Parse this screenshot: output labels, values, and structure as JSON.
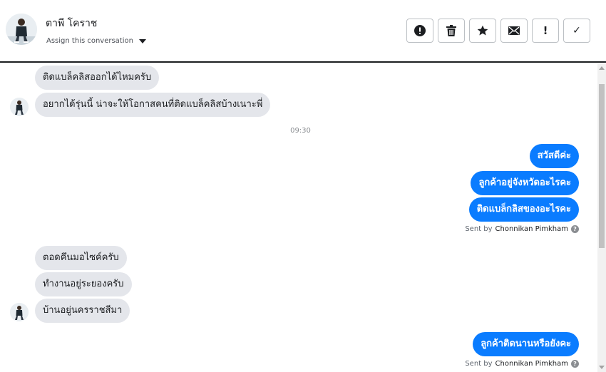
{
  "header": {
    "contact_name": "ตาพี โคราช",
    "assign_label": "Assign this conversation",
    "actions": {
      "spam": "exclamation-circle-icon",
      "delete": "trash-icon",
      "star": "star-icon",
      "mark_unread": "envelope-icon",
      "follow_up": "exclamation-icon",
      "done": "checkmark-icon"
    },
    "action_labels": [
      "!",
      "✓"
    ]
  },
  "conversation": {
    "group1": [
      "ติดแบล็คลิสออกได้ไหมครับ",
      "อยากได้รุ่นนี้ น่าจะให้โอกาสคนที่ติดแบล็คลิสบ้างเนาะพี่"
    ],
    "timestamp": "09:30",
    "group2": [
      "สวัสดีค่ะ",
      "ลูกค้าอยู่จังหวัดอะไรคะ",
      "ติดแบล็กลิสของอะไรคะ"
    ],
    "sent_by_prefix": "Sent by",
    "agent_name": "Chonnikan Pimkham",
    "help_glyph": "?",
    "group3": [
      "ตอดคึนมอไซค์ครับ",
      "ทำงานอยู่ระยองครับ",
      "บ้านอยู่นครราชสีมา"
    ],
    "group4": [
      "ลูกค้าติดนานหรือยังคะ"
    ]
  },
  "colors": {
    "outgoing_bubble": "#0a7cff",
    "incoming_bubble": "#e4e6eb",
    "header_border": "#1c1e21"
  }
}
